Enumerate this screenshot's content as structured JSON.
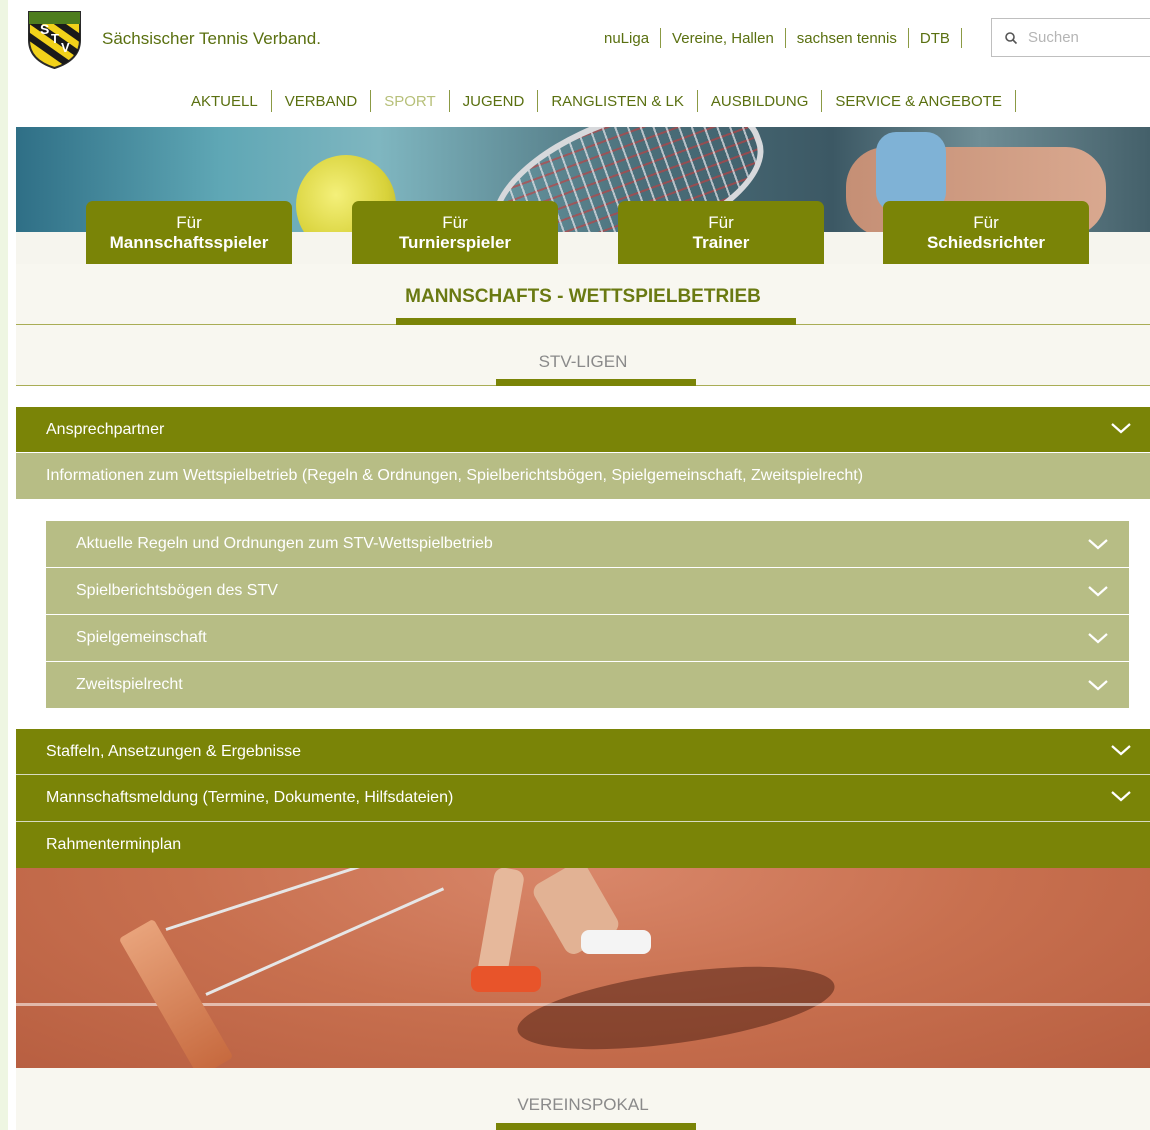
{
  "brand": {
    "logo_text": "STV",
    "site_name": "Sächsischer Tennis Verband."
  },
  "top_links": [
    "nuLiga",
    "Vereine, Hallen",
    "sachsen tennis",
    "DTB"
  ],
  "search": {
    "placeholder": "Suchen"
  },
  "main_nav": [
    {
      "label": "AKTUELL",
      "active": false
    },
    {
      "label": "VERBAND",
      "active": false
    },
    {
      "label": "SPORT",
      "active": true
    },
    {
      "label": "JUGEND",
      "active": false
    },
    {
      "label": "RANGLISTEN & LK",
      "active": false
    },
    {
      "label": "AUSBILDUNG",
      "active": false
    },
    {
      "label": "SERVICE & ANGEBOTE",
      "active": false
    }
  ],
  "audience_tabs": [
    {
      "line1": "Für",
      "line2": "Mannschaftsspieler"
    },
    {
      "line1": "Für",
      "line2": "Turnierspieler"
    },
    {
      "line1": "Für",
      "line2": "Trainer"
    },
    {
      "line1": "Für",
      "line2": "Schiedsrichter"
    }
  ],
  "section_title": "MANNSCHAFTS - WETTSPIELBETRIEB",
  "subsection_title": "STV-LIGEN",
  "accordion": {
    "ansprechpartner": "Ansprechpartner",
    "informationen": "Informationen zum Wettspielbetrieb (Regeln & Ordnungen, Spielberichtsbögen, Spielgemeinschaft, Zweitspielrecht)",
    "sub_items": [
      "Aktuelle Regeln und Ordnungen zum STV-Wettspielbetrieb",
      "Spielberichtsbögen des STV",
      "Spielgemeinschaft",
      "Zweitspielrecht"
    ],
    "staffeln": "Staffeln, Ansetzungen & Ergebnisse",
    "mannschaftsmeldung": "Mannschaftsmeldung (Termine, Dokumente, Hilfsdateien)",
    "rahmenterminplan": "Rahmenterminplan"
  },
  "next_section_title": "VEREINSPOKAL",
  "colors": {
    "brand_green": "#7a8407",
    "light_green": "#b7bd85",
    "text_green": "#5a7010"
  }
}
